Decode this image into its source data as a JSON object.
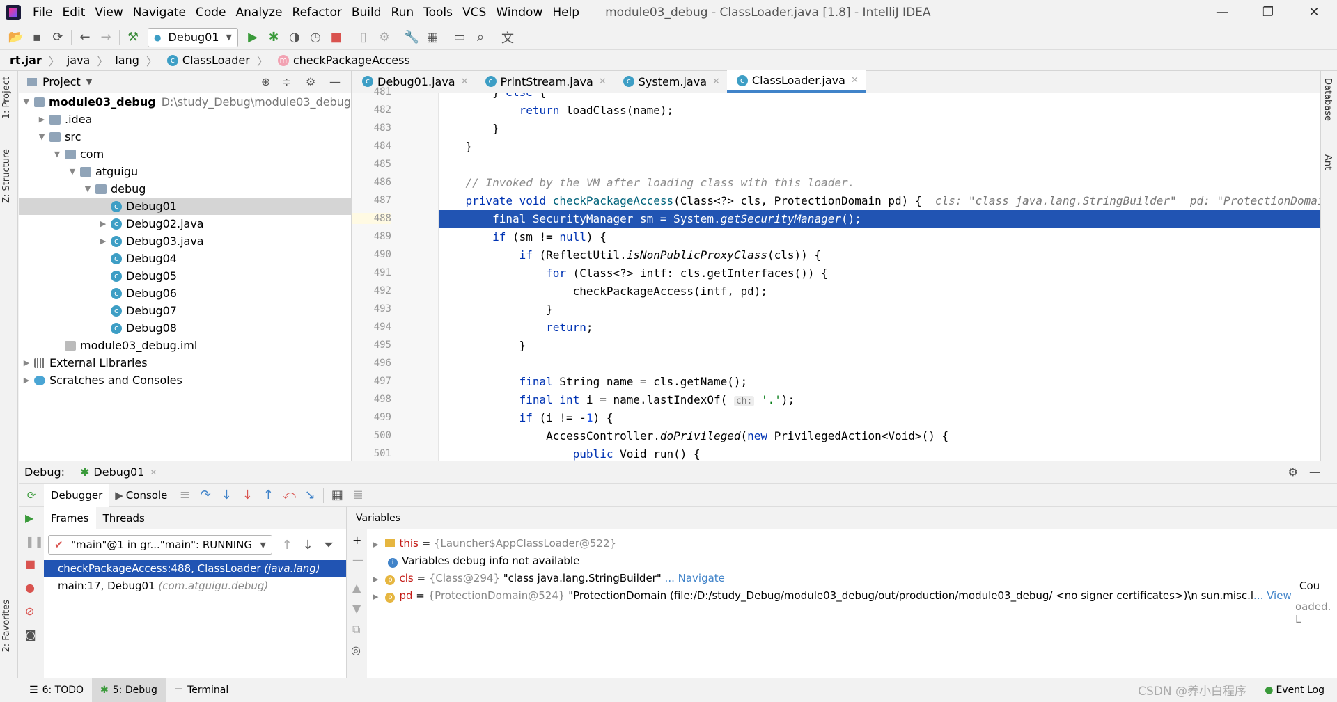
{
  "menubar": {
    "items": [
      "File",
      "Edit",
      "View",
      "Navigate",
      "Code",
      "Analyze",
      "Refactor",
      "Build",
      "Run",
      "Tools",
      "VCS",
      "Window",
      "Help"
    ],
    "title": "module03_debug - ClassLoader.java [1.8] - IntelliJ IDEA",
    "min": "—",
    "max": "❐",
    "close": "✕"
  },
  "toolbar": {
    "run_config": "Debug01"
  },
  "breadcrumb": [
    "rt.jar",
    "java",
    "lang",
    "ClassLoader",
    "checkPackageAccess"
  ],
  "leftstrip": {
    "project": "1: Project",
    "structure": "Z: Structure",
    "favorites": "2: Favorites"
  },
  "rightstrip": {
    "database": "Database",
    "ant": "Ant"
  },
  "project": {
    "title": "Project",
    "tree": [
      {
        "label": "module03_debug",
        "extra": "D:\\study_Debug\\module03_debug",
        "indent": 0,
        "arrow": "▼",
        "icon": "folder",
        "bold": true
      },
      {
        "label": ".idea",
        "indent": 1,
        "arrow": "▶",
        "icon": "folder"
      },
      {
        "label": "src",
        "indent": 1,
        "arrow": "▼",
        "icon": "folder"
      },
      {
        "label": "com",
        "indent": 2,
        "arrow": "▼",
        "icon": "folder"
      },
      {
        "label": "atguigu",
        "indent": 3,
        "arrow": "▼",
        "icon": "folder"
      },
      {
        "label": "debug",
        "indent": 4,
        "arrow": "▼",
        "icon": "folder"
      },
      {
        "label": "Debug01",
        "indent": 5,
        "arrow": "",
        "icon": "class",
        "selected": true
      },
      {
        "label": "Debug02.java",
        "indent": 5,
        "arrow": "▶",
        "icon": "class"
      },
      {
        "label": "Debug03.java",
        "indent": 5,
        "arrow": "▶",
        "icon": "class"
      },
      {
        "label": "Debug04",
        "indent": 5,
        "arrow": "",
        "icon": "class"
      },
      {
        "label": "Debug05",
        "indent": 5,
        "arrow": "",
        "icon": "class"
      },
      {
        "label": "Debug06",
        "indent": 5,
        "arrow": "",
        "icon": "class"
      },
      {
        "label": "Debug07",
        "indent": 5,
        "arrow": "",
        "icon": "class"
      },
      {
        "label": "Debug08",
        "indent": 5,
        "arrow": "",
        "icon": "class"
      },
      {
        "label": "module03_debug.iml",
        "indent": 2,
        "arrow": "",
        "icon": "file"
      },
      {
        "label": "External Libraries",
        "indent": 0,
        "arrow": "▶",
        "icon": "lib"
      },
      {
        "label": "Scratches and Consoles",
        "indent": 0,
        "arrow": "▶",
        "icon": "scratch"
      }
    ]
  },
  "editor": {
    "tabs": [
      "Debug01.java",
      "PrintStream.java",
      "System.java",
      "ClassLoader.java"
    ],
    "active_tab": 3,
    "line_numbers": [
      "481",
      "482",
      "483",
      "484",
      "485",
      "486",
      "487",
      "488",
      "489",
      "490",
      "491",
      "492",
      "493",
      "494",
      "495",
      "496",
      "497",
      "498",
      "499",
      "500",
      "501"
    ]
  },
  "debug": {
    "label": "Debug:",
    "session": "Debug01",
    "tabs": [
      "Debugger",
      "Console"
    ],
    "frames_tab": "Frames",
    "threads_tab": "Threads",
    "thread_select": "\"main\"@1 in gr...\"main\": RUNNING",
    "frames": [
      {
        "method": "checkPackageAccess:488, ClassLoader",
        "pkg": "(java.lang)",
        "selected": true
      },
      {
        "method": "main:17, Debug01",
        "pkg": "(com.atguigu.debug)",
        "selected": false
      }
    ],
    "variables_label": "Variables",
    "variables": [
      {
        "name": "this",
        "type": "{Launcher$AppClassLoader@522}",
        "value": "",
        "link": ""
      },
      {
        "name": "",
        "type": "",
        "value": "Variables debug info not available",
        "link": ""
      },
      {
        "name": "cls",
        "type": "{Class@294}",
        "value": "\"class java.lang.StringBuilder\"",
        "link": "... Navigate"
      },
      {
        "name": "pd",
        "type": "{ProtectionDomain@524}",
        "value": "\"ProtectionDomain  (file:/D:/study_Debug/module03_debug/out/production/module03_debug/ <no signer certificates>)\\n sun.misc.l",
        "link": "... View"
      }
    ],
    "watches_partial": [
      "Cou",
      "oaded. L"
    ]
  },
  "statusbar": {
    "todo": "6: TODO",
    "debug": "5: Debug",
    "terminal": "Terminal",
    "eventlog": "Event Log",
    "watermark": "CSDN @养小白程序"
  }
}
